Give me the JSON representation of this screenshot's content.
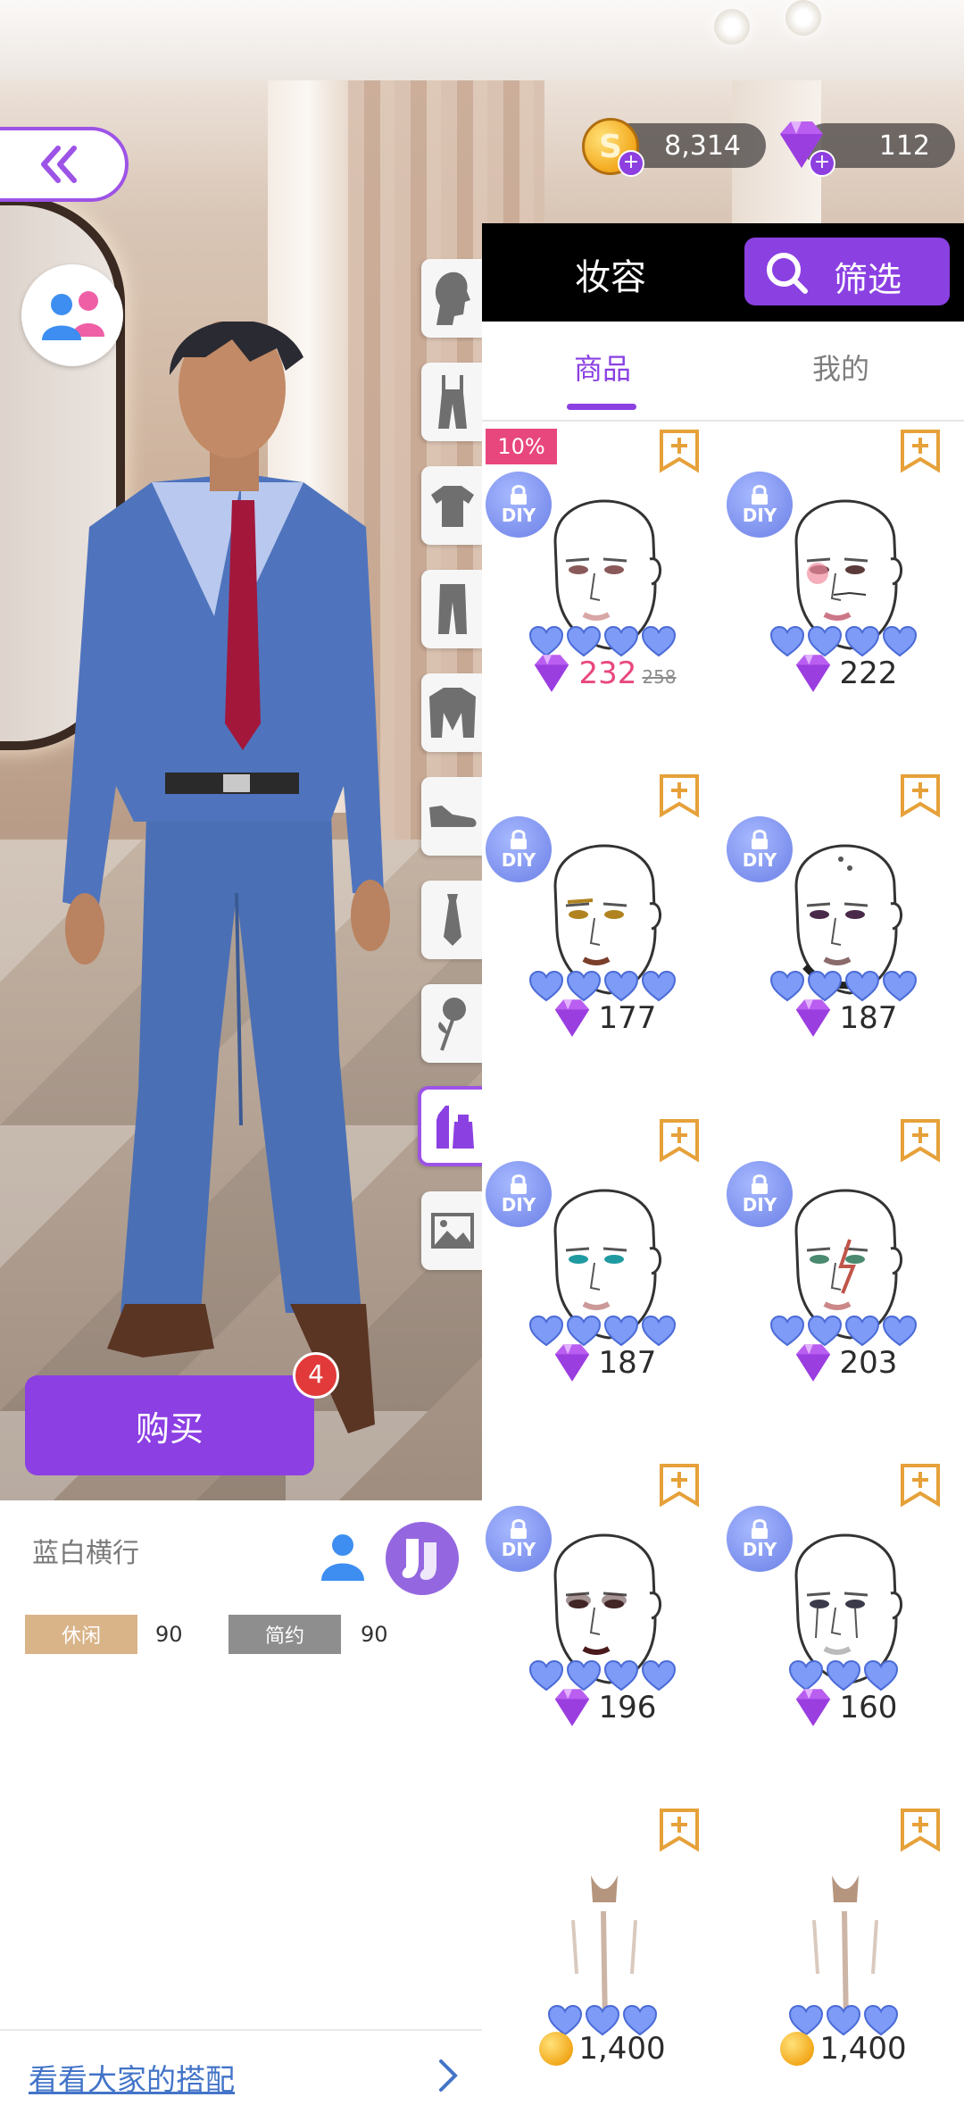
{
  "currency": {
    "coins": "8,314",
    "gems": "112",
    "coin_symbol": "S",
    "plus": "+"
  },
  "panel": {
    "title": "妆容",
    "filter_label": "筛选",
    "tabs": [
      {
        "label": "商品",
        "active": true
      },
      {
        "label": "我的",
        "active": false
      }
    ],
    "items": [
      {
        "discount_badge": "10%",
        "diy": "DIY",
        "hearts": 4,
        "price": "232",
        "old_price": "258",
        "currency": "gem",
        "variant": "pale-blush"
      },
      {
        "discount_badge": "",
        "diy": "DIY",
        "hearts": 4,
        "price": "222",
        "currency": "gem",
        "variant": "red-cheek-mustache"
      },
      {
        "discount_badge": "",
        "diy": "DIY",
        "hearts": 4,
        "price": "177",
        "currency": "gem",
        "variant": "gold-liner"
      },
      {
        "discount_badge": "",
        "diy": "DIY",
        "hearts": 4,
        "price": "187",
        "currency": "gem",
        "variant": "cyborg"
      },
      {
        "discount_badge": "",
        "diy": "DIY",
        "hearts": 4,
        "price": "187",
        "currency": "gem",
        "variant": "teal-eye"
      },
      {
        "discount_badge": "",
        "diy": "DIY",
        "hearts": 4,
        "price": "203",
        "currency": "gem",
        "variant": "lightning-scar"
      },
      {
        "discount_badge": "",
        "diy": "DIY",
        "hearts": 4,
        "price": "196",
        "currency": "gem",
        "variant": "dark-smoky"
      },
      {
        "discount_badge": "",
        "diy": "DIY",
        "hearts": 3,
        "price": "160",
        "currency": "gem",
        "variant": "tear-streak"
      },
      {
        "discount_badge": "",
        "diy": "",
        "hearts": 3,
        "price": "1,400",
        "currency": "coin",
        "variant": "chest-hair"
      },
      {
        "discount_badge": "",
        "diy": "",
        "hearts": 3,
        "price": "1,400",
        "currency": "coin",
        "variant": "body-hair"
      }
    ]
  },
  "categories": [
    "head",
    "overalls",
    "shirt",
    "pants",
    "coat",
    "shoes",
    "tie",
    "rose-accessory",
    "makeup",
    "background"
  ],
  "active_category": "makeup",
  "buy": {
    "label": "购买",
    "count": "4"
  },
  "outfit": {
    "name": "蓝白横行",
    "tags": [
      {
        "label": "休闲",
        "value": "90",
        "color": "#d9b489"
      },
      {
        "label": "简约",
        "value": "90",
        "color": "#8e8e8e"
      }
    ]
  },
  "see_others": "看看大家的搭配",
  "colors": {
    "accent": "#8b40e2",
    "discount": "#e8477e",
    "heart": "#7d9bf7",
    "bookmark": "#e6a13a",
    "link": "#4374c8"
  }
}
